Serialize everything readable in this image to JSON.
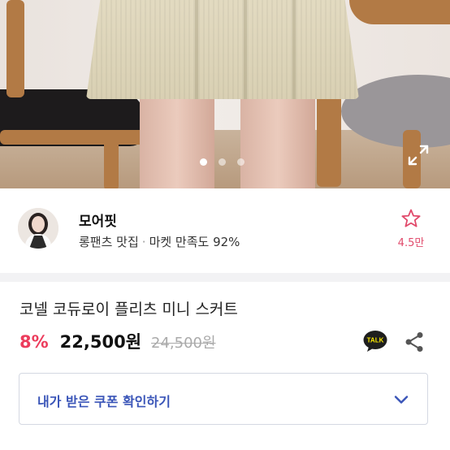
{
  "gallery": {
    "image_description": "product-photo-skirt",
    "slide_count": 3,
    "active_slide": 1
  },
  "seller": {
    "name": "모어핏",
    "tagline": "롱팬츠 맛집",
    "separator": "·",
    "satisfaction": "마켓 만족도 92%",
    "favorite_count": "4.5만"
  },
  "product": {
    "title": "코넬 코듀로이 플리츠 미니 스커트",
    "discount": "8%",
    "price": "22,500원",
    "original_price": "24,500원"
  },
  "coupon": {
    "label": "내가 받은 쿠폰 확인하기"
  },
  "icons": {
    "expand": "expand-icon",
    "favorite": "star-icon",
    "talk": "kakao-talk-icon",
    "share": "share-icon",
    "chevron": "chevron-down-icon"
  },
  "colors": {
    "accent": "#ec3c5c",
    "coupon_text": "#3a55b8",
    "talk_bg": "#1e1e1e"
  }
}
